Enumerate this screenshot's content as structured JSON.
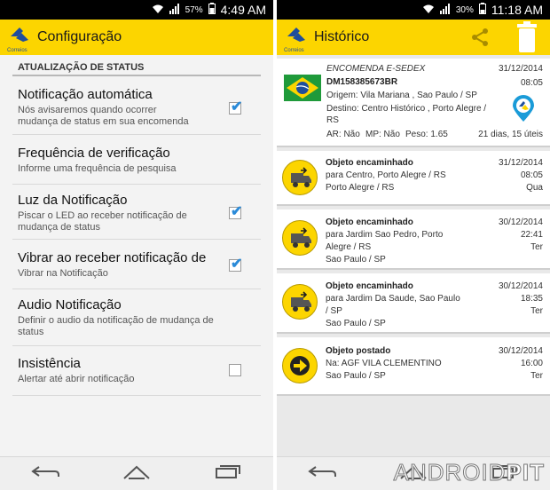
{
  "left": {
    "status_bar": {
      "battery": "57%",
      "time": "4:49 AM"
    },
    "app_bar": {
      "logo_text": "Correios",
      "title": "Configuração"
    },
    "section_header": "ATUALIZAÇÃO DE STATUS",
    "prefs": [
      {
        "title": "Notificação automática",
        "summary1": "Nós avisaremos quando ocorrer",
        "summary2": "mudança de status em sua encomenda",
        "checkbox": true,
        "checked": true
      },
      {
        "title": "Frequência de verificação",
        "summary1": "Informe uma frequência de pesquisa",
        "summary2": "",
        "checkbox": false,
        "checked": false
      },
      {
        "title": "Luz da Notificação",
        "summary1": "Piscar o LED ao receber notificação de",
        "summary2": "mudança de status",
        "checkbox": true,
        "checked": true
      },
      {
        "title": "Vibrar ao receber notificação de",
        "summary1": "Vibrar na Notificação",
        "summary2": "",
        "checkbox": true,
        "checked": true
      },
      {
        "title": "Audio Notificação",
        "summary1": "Definir o audio da notificação de mudança de",
        "summary2": "status",
        "checkbox": false,
        "checked": false
      },
      {
        "title": "Insistência",
        "summary1": "Alertar até abrir notificação",
        "summary2": "",
        "checkbox": true,
        "checked": false
      }
    ]
  },
  "right": {
    "status_bar": {
      "battery": "30%",
      "time": "11:18 AM"
    },
    "app_bar": {
      "logo_text": "Correios",
      "title": "Histórico"
    },
    "package": {
      "service": "ENCOMENDA E-SEDEX",
      "code": "DM158385673BR",
      "origin": "Origem: Vila Mariana , Sao Paulo / SP",
      "destination1": "Destino: Centro Histórico , Porto Alegre /",
      "destination2": "RS",
      "ar": "AR: Não",
      "mp": "MP: Não",
      "weight": "Peso: 1.65",
      "date": "31/12/2014",
      "time": "08:05",
      "elapsed": "21 dias, 15 úteis"
    },
    "events": [
      {
        "title": "Objeto encaminhado",
        "l1": "para Centro, Porto Alegre / RS",
        "l2": "Porto Alegre / RS",
        "l3": "",
        "date": "31/12/2014",
        "time": "08:05",
        "day": "Qua",
        "icon": "truck-icon"
      },
      {
        "title": "Objeto encaminhado",
        "l1": "para Jardim Sao Pedro, Porto",
        "l2": "Alegre / RS",
        "l3": "Sao Paulo / SP",
        "date": "30/12/2014",
        "time": "22:41",
        "day": "Ter",
        "icon": "truck-icon"
      },
      {
        "title": "Objeto encaminhado",
        "l1": "para Jardim Da Saude, Sao Paulo",
        "l2": "/ SP",
        "l3": "Sao Paulo / SP",
        "date": "30/12/2014",
        "time": "18:35",
        "day": "Ter",
        "icon": "truck-icon"
      },
      {
        "title": "Objeto postado",
        "l1": "Na: AGF VILA CLEMENTINO",
        "l2": "Sao Paulo / SP",
        "l3": "",
        "date": "30/12/2014",
        "time": "16:00",
        "day": "Ter",
        "icon": "arrow-right-icon"
      }
    ]
  },
  "watermark": {
    "part1": "ANDROID",
    "part2": "PIT"
  },
  "colors": {
    "accent_yellow": "#fcd500",
    "check_blue": "#2a8ad8",
    "correios_blue": "#1f4e9c"
  }
}
